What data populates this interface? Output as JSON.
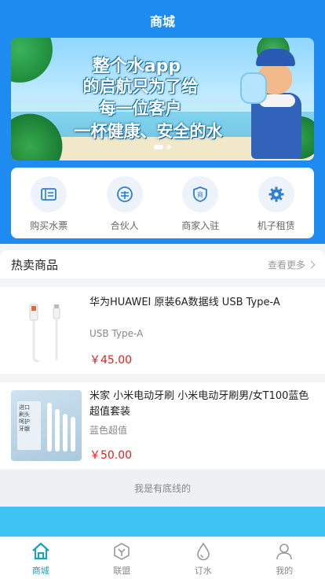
{
  "app": {
    "title": "商城"
  },
  "banner": {
    "lines": [
      "整个水app",
      "的启航只为了给",
      "每一位客户",
      "一杯健康、安全的水"
    ],
    "slide_count": 2,
    "active_slide": 1
  },
  "categories": [
    {
      "label": "购买水票",
      "icon": "ticket-icon"
    },
    {
      "label": "合伙人",
      "icon": "partner-coin-icon"
    },
    {
      "label": "商家入驻",
      "icon": "merchant-shield-icon"
    },
    {
      "label": "机子租赁",
      "icon": "gear-icon"
    }
  ],
  "hot_section": {
    "title": "热卖商品",
    "more_label": "查看更多"
  },
  "products": [
    {
      "name": "华为HUAWEI 原装6A数据线 USB Type-A",
      "spec": "USB Type-A",
      "price": "￥45.00"
    },
    {
      "name": "米家 小米电动牙刷 小米电动牙刷男/女T100蓝色超值套装",
      "spec": "蓝色超值",
      "price": "￥50.00"
    }
  ],
  "end_text": "我是有底线的",
  "tabbar": [
    {
      "label": "商城",
      "icon": "home-icon",
      "active": true
    },
    {
      "label": "联盟",
      "icon": "alliance-icon",
      "active": false
    },
    {
      "label": "订水",
      "icon": "water-drop-icon",
      "active": false
    },
    {
      "label": "我的",
      "icon": "user-icon",
      "active": false
    }
  ],
  "colors": {
    "primary": "#1e8bf1",
    "price": "#e0201d",
    "tab_active": "#1aa3c0"
  }
}
